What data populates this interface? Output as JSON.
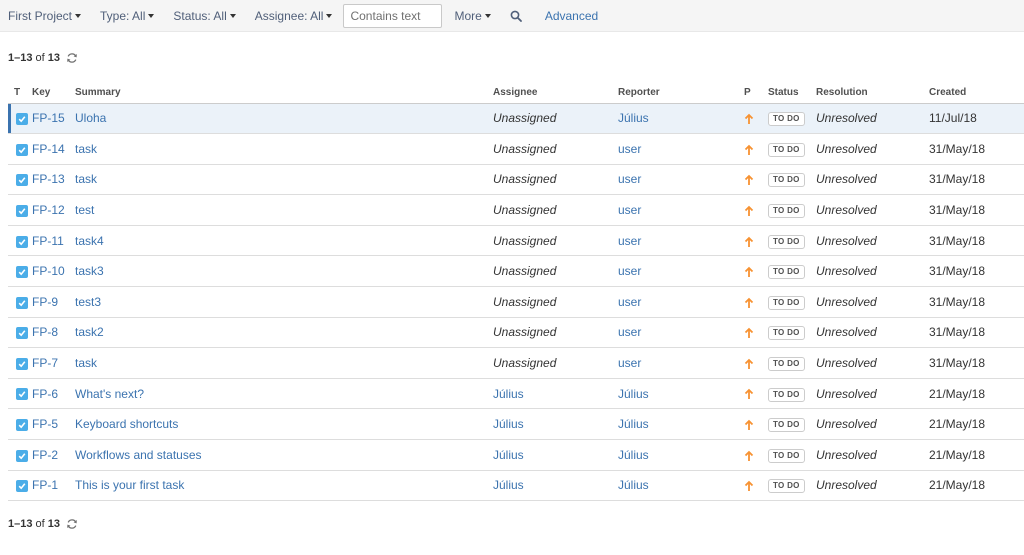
{
  "toolbar": {
    "project": "First Project",
    "type": "Type: All",
    "status": "Status: All",
    "assignee": "Assignee: All",
    "search_placeholder": "Contains text",
    "more": "More",
    "advanced": "Advanced"
  },
  "pager": {
    "range": "1–13",
    "of": "of",
    "total": "13"
  },
  "columns": {
    "type": "T",
    "key": "Key",
    "summary": "Summary",
    "assignee": "Assignee",
    "reporter": "Reporter",
    "priority": "P",
    "status": "Status",
    "resolution": "Resolution",
    "created": "Created"
  },
  "colors": {
    "link": "#3b73af",
    "type_icon": "#4bade8",
    "priority": "#f79232",
    "selected_row": "#ebf2f9"
  },
  "icons": {
    "type": "checkbox-task-icon",
    "priority": "arrow-up-priority-icon",
    "search": "search-icon",
    "refresh": "refresh-icon"
  },
  "issues": [
    {
      "key": "FP-15",
      "summary": "Uloha",
      "assignee": "Unassigned",
      "assignee_unassigned": true,
      "reporter": "Július",
      "status": "TO DO",
      "resolution": "Unresolved",
      "created": "11/Jul/18",
      "selected": true
    },
    {
      "key": "FP-14",
      "summary": "task",
      "assignee": "Unassigned",
      "assignee_unassigned": true,
      "reporter": "user",
      "status": "TO DO",
      "resolution": "Unresolved",
      "created": "31/May/18"
    },
    {
      "key": "FP-13",
      "summary": "task",
      "assignee": "Unassigned",
      "assignee_unassigned": true,
      "reporter": "user",
      "status": "TO DO",
      "resolution": "Unresolved",
      "created": "31/May/18"
    },
    {
      "key": "FP-12",
      "summary": "test",
      "assignee": "Unassigned",
      "assignee_unassigned": true,
      "reporter": "user",
      "status": "TO DO",
      "resolution": "Unresolved",
      "created": "31/May/18"
    },
    {
      "key": "FP-11",
      "summary": "task4",
      "assignee": "Unassigned",
      "assignee_unassigned": true,
      "reporter": "user",
      "status": "TO DO",
      "resolution": "Unresolved",
      "created": "31/May/18"
    },
    {
      "key": "FP-10",
      "summary": "task3",
      "assignee": "Unassigned",
      "assignee_unassigned": true,
      "reporter": "user",
      "status": "TO DO",
      "resolution": "Unresolved",
      "created": "31/May/18"
    },
    {
      "key": "FP-9",
      "summary": "test3",
      "assignee": "Unassigned",
      "assignee_unassigned": true,
      "reporter": "user",
      "status": "TO DO",
      "resolution": "Unresolved",
      "created": "31/May/18"
    },
    {
      "key": "FP-8",
      "summary": "task2",
      "assignee": "Unassigned",
      "assignee_unassigned": true,
      "reporter": "user",
      "status": "TO DO",
      "resolution": "Unresolved",
      "created": "31/May/18"
    },
    {
      "key": "FP-7",
      "summary": "task",
      "assignee": "Unassigned",
      "assignee_unassigned": true,
      "reporter": "user",
      "status": "TO DO",
      "resolution": "Unresolved",
      "created": "31/May/18"
    },
    {
      "key": "FP-6",
      "summary": "What's next?",
      "assignee": "Július",
      "assignee_unassigned": false,
      "reporter": "Július",
      "status": "TO DO",
      "resolution": "Unresolved",
      "created": "21/May/18"
    },
    {
      "key": "FP-5",
      "summary": "Keyboard shortcuts",
      "assignee": "Július",
      "assignee_unassigned": false,
      "reporter": "Július",
      "status": "TO DO",
      "resolution": "Unresolved",
      "created": "21/May/18"
    },
    {
      "key": "FP-2",
      "summary": "Workflows and statuses",
      "assignee": "Július",
      "assignee_unassigned": false,
      "reporter": "Július",
      "status": "TO DO",
      "resolution": "Unresolved",
      "created": "21/May/18"
    },
    {
      "key": "FP-1",
      "summary": "This is your first task",
      "assignee": "Július",
      "assignee_unassigned": false,
      "reporter": "Július",
      "status": "TO DO",
      "resolution": "Unresolved",
      "created": "21/May/18"
    }
  ]
}
